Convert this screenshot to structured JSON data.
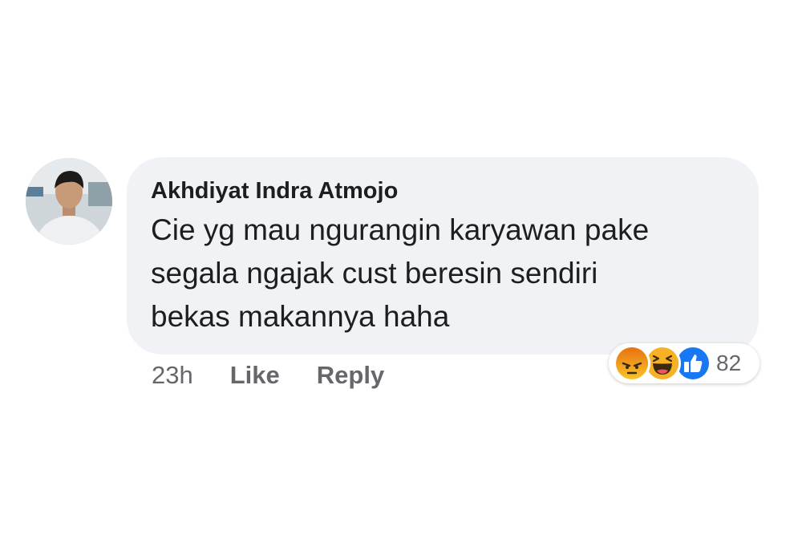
{
  "comment": {
    "author": "Akhdiyat Indra Atmojo",
    "text_lines": [
      "Cie yg mau ngurangin karyawan pake",
      "segala ngajak cust beresin sendiri",
      "bekas makannya haha"
    ],
    "timestamp": "23h",
    "like_label": "Like",
    "reply_label": "Reply"
  },
  "reactions": {
    "icons": [
      "angry-reaction-icon",
      "haha-reaction-icon",
      "like-reaction-icon"
    ],
    "count": "82"
  },
  "colors": {
    "bubble": "#f0f2f5",
    "text": "#1c1e21",
    "secondary_text": "#65676b",
    "like_blue": "#1877f2",
    "angry_orange": "#e9710f",
    "haha_yellow": "#f7b125"
  }
}
